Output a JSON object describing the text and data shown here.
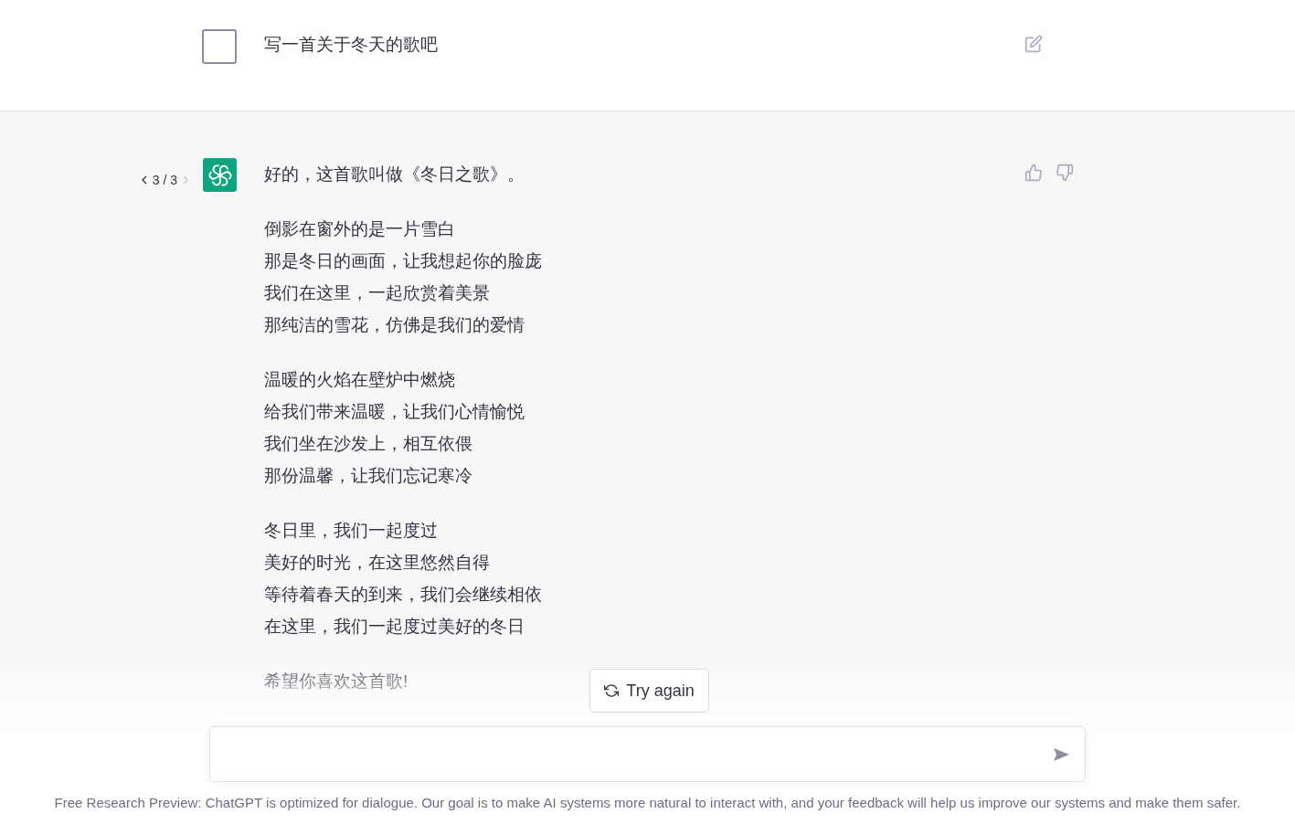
{
  "user_message": {
    "text": "写一首关于冬天的歌吧"
  },
  "assistant_message": {
    "pager": {
      "text": "3 / 3",
      "prev_disabled": false,
      "next_disabled": true
    },
    "intro": "好的，这首歌叫做《冬日之歌》。",
    "stanzas": [
      [
        "倒影在窗外的是一片雪白",
        "那是冬日的画面，让我想起你的脸庞",
        "我们在这里，一起欣赏着美景",
        "那纯洁的雪花，仿佛是我们的爱情"
      ],
      [
        "温暖的火焰在壁炉中燃烧",
        "给我们带来温暖，让我们心情愉悦",
        "我们坐在沙发上，相互依偎",
        "那份温馨，让我们忘记寒冷"
      ],
      [
        "冬日里，我们一起度过",
        "美好的时光，在这里悠然自得",
        "等待着春天的到来，我们会继续相依",
        "在这里，我们一起度过美好的冬日"
      ]
    ],
    "outro": "希望你喜欢这首歌!"
  },
  "try_again_button": {
    "label": "Try again"
  },
  "footer": "Free Research Preview: ChatGPT is optimized for dialogue. Our goal is to make AI systems more natural to interact with, and your feedback will help us improve our systems and make them safer."
}
